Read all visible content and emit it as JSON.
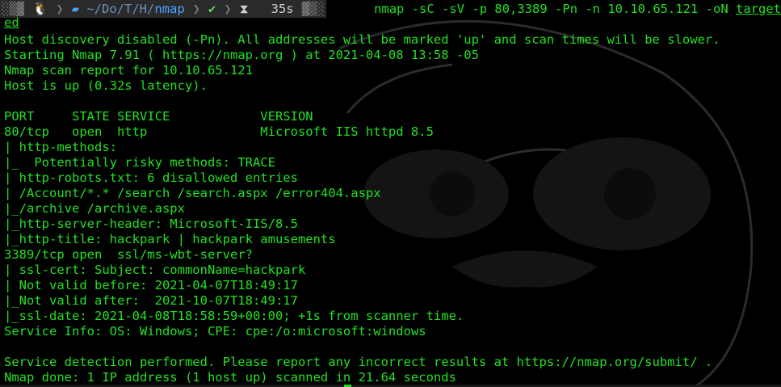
{
  "prompt": {
    "os_icon": "linux-penguin-icon",
    "folder_icon": "folder-icon",
    "path_dim": "~/Do/T/H/",
    "path_current": "nmap",
    "status_icon": "check-icon",
    "timer_icon": "hourglass-icon",
    "duration": "35s",
    "command_main": "nmap -sC -sV -p 80,3389 -Pn -n 10.10.65.121 -oN ",
    "command_file_part1": "target",
    "command_file_part2": "ed"
  },
  "output": [
    "Host discovery disabled (-Pn). All addresses will be marked 'up' and scan times will be slower.",
    "Starting Nmap 7.91 ( https://nmap.org ) at 2021-04-08 13:58 -05",
    "Nmap scan report for 10.10.65.121",
    "Host is up (0.32s latency).",
    "",
    "PORT     STATE SERVICE            VERSION",
    "80/tcp   open  http               Microsoft IIS httpd 8.5",
    "| http-methods:",
    "|_  Potentially risky methods: TRACE",
    "| http-robots.txt: 6 disallowed entries",
    "| /Account/*.* /search /search.aspx /error404.aspx",
    "|_/archive /archive.aspx",
    "|_http-server-header: Microsoft-IIS/8.5",
    "|_http-title: hackpark | hackpark amusements",
    "3389/tcp open  ssl/ms-wbt-server?",
    "| ssl-cert: Subject: commonName=hackpark",
    "| Not valid before: 2021-04-07T18:49:17",
    "|_Not valid after:  2021-10-07T18:49:17",
    "|_ssl-date: 2021-04-08T18:58:59+00:00; +1s from scanner time.",
    "Service Info: OS: Windows; CPE: cpe:/o:microsoft:windows",
    "",
    "Service detection performed. Please report any incorrect results at https://nmap.org/submit/ .",
    "Nmap done: 1 IP address (1 host up) scanned in 21.64 seconds"
  ],
  "colors": {
    "text": "#22e022",
    "prompt_bg": "#2a2a2a",
    "path": "#4aa3ff"
  }
}
